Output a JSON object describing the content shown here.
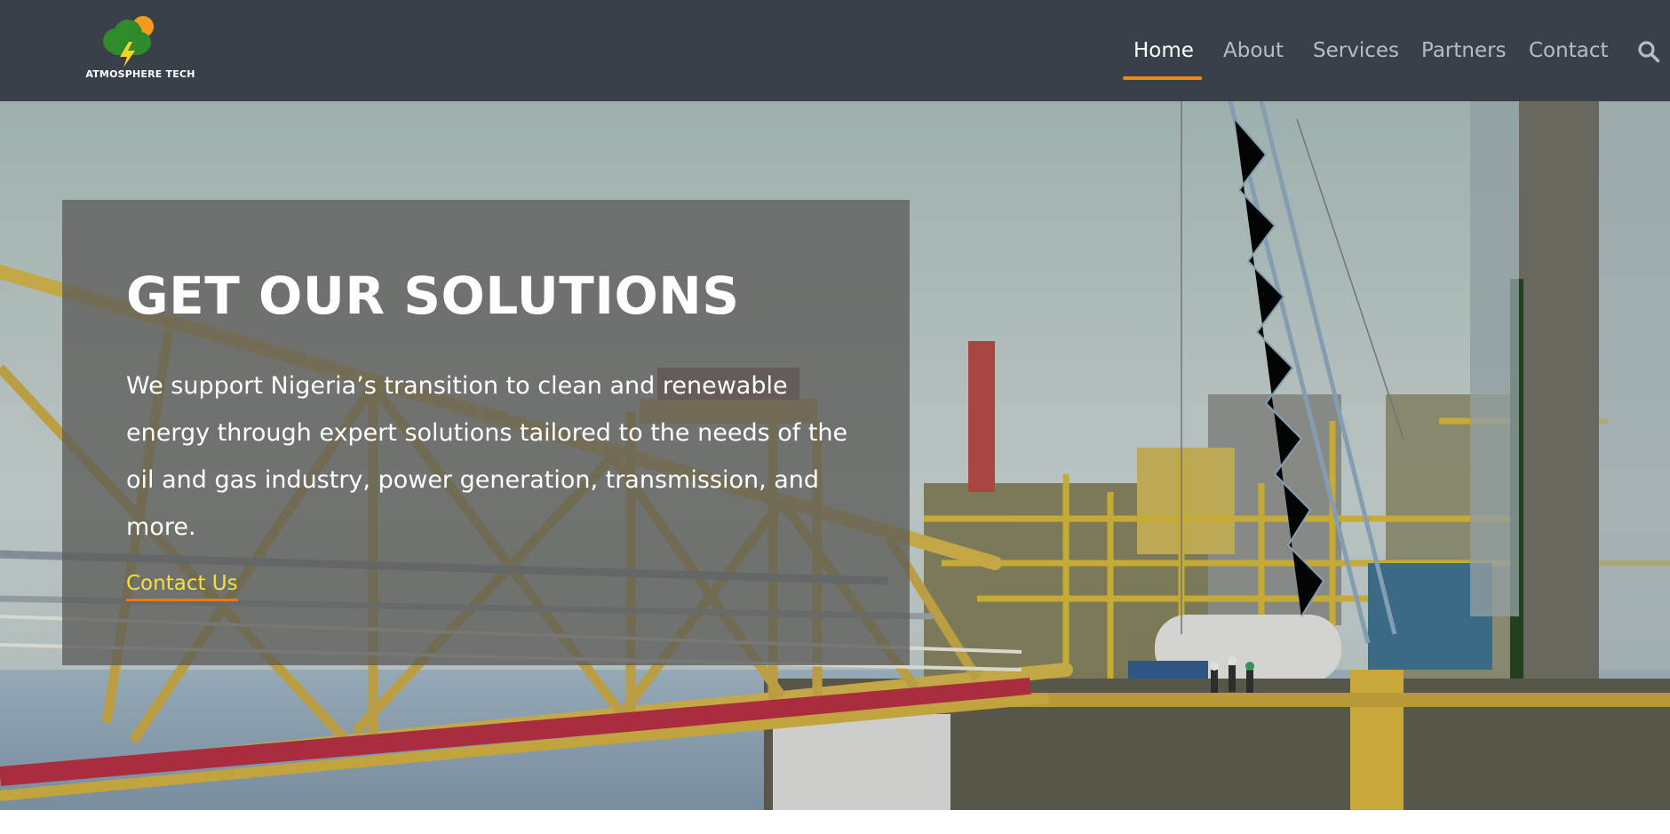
{
  "brand": {
    "name": "ATMOSPHERE TECH",
    "logo_icon": "storm-cloud-sun-lightning-icon",
    "colors": {
      "cloud": "#2f8a2a",
      "sun": "#f39a1f",
      "bolt": "#f5d32a"
    }
  },
  "nav": {
    "items": [
      {
        "label": "Home",
        "active": true
      },
      {
        "label": "About",
        "active": false
      },
      {
        "label": "Services",
        "active": false
      },
      {
        "label": "Partners",
        "active": false
      },
      {
        "label": "Contact",
        "active": false
      }
    ],
    "search_icon": "search-icon"
  },
  "hero": {
    "title": "GET OUR SOLUTIONS",
    "description": "We support Nigeria’s transition to clean and renewable energy through expert solutions tailored to the needs of the oil and gas industry, power generation, transmission, and more.",
    "cta_label": "Contact Us",
    "background_image": "offshore-oil-platform-photo"
  },
  "theme": {
    "header_bg": "#3a4049",
    "accent": "#f08a15",
    "cta_text": "#f5e13a"
  }
}
